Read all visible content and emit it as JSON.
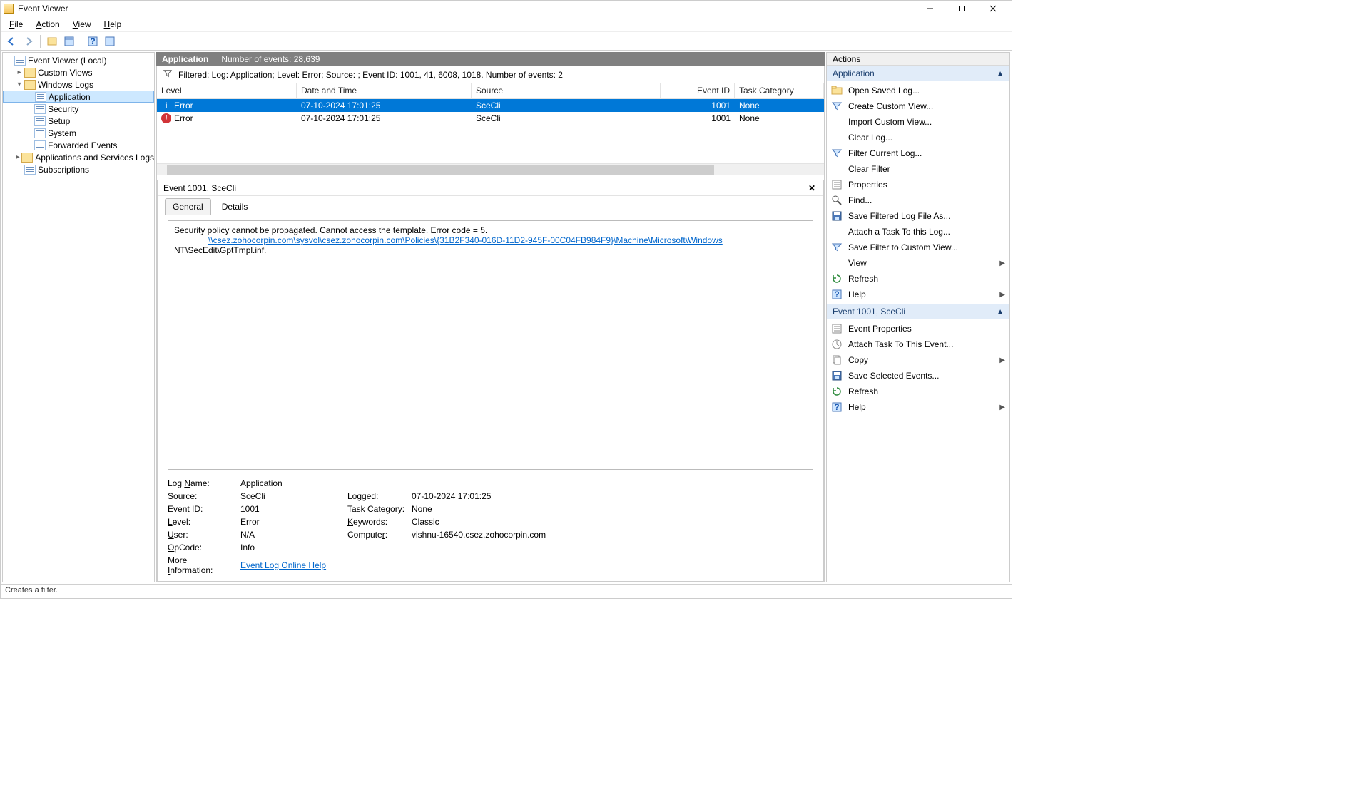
{
  "window": {
    "title": "Event Viewer"
  },
  "menu": {
    "file": "File",
    "action": "Action",
    "view": "View",
    "help": "Help"
  },
  "tree": {
    "root": "Event Viewer (Local)",
    "customViews": "Custom Views",
    "windowsLogs": "Windows Logs",
    "application": "Application",
    "security": "Security",
    "setup": "Setup",
    "system": "System",
    "forwarded": "Forwarded Events",
    "appsServices": "Applications and Services Logs",
    "subscriptions": "Subscriptions"
  },
  "centerHeader": {
    "title": "Application",
    "subtitle": "Number of events: 28,639"
  },
  "filterBar": "Filtered: Log: Application; Level: Error; Source: ; Event ID: 1001, 41, 6008, 1018. Number of events: 2",
  "columns": {
    "level": "Level",
    "date": "Date and Time",
    "source": "Source",
    "id": "Event ID",
    "cat": "Task Category"
  },
  "rows": [
    {
      "level": "Error",
      "date": "07-10-2024 17:01:25",
      "source": "SceCli",
      "id": "1001",
      "cat": "None",
      "selected": true,
      "icon": "info"
    },
    {
      "level": "Error",
      "date": "07-10-2024 17:01:25",
      "source": "SceCli",
      "id": "1001",
      "cat": "None",
      "selected": false,
      "icon": "error"
    }
  ],
  "detail": {
    "header": "Event 1001, SceCli",
    "tabs": {
      "general": "General",
      "details": "Details"
    },
    "msg_line1": "Security policy cannot be propagated. Cannot access the template. Error code = 5.",
    "msg_link": "\\\\csez.zohocorpin.com\\sysvol\\csez.zohocorpin.com\\Policies\\{31B2F340-016D-11D2-945F-00C04FB984F9}\\Machine\\Microsoft\\Windows",
    "msg_tail": " NT\\SecEdit\\GptTmpl.inf.",
    "props": {
      "logNameLbl": "Log Name:",
      "logName": "Application",
      "sourceLbl": "Source:",
      "source": "SceCli",
      "loggedLbl": "Logged:",
      "logged": "07-10-2024 17:01:25",
      "eventIdLbl": "Event ID:",
      "eventId": "1001",
      "taskCatLbl": "Task Category:",
      "taskCat": "None",
      "levelLbl": "Level:",
      "level": "Error",
      "keywordsLbl": "Keywords:",
      "keywords": "Classic",
      "userLbl": "User:",
      "user": "N/A",
      "computerLbl": "Computer:",
      "computer": "vishnu-16540.csez.zohocorpin.com",
      "opCodeLbl": "OpCode:",
      "opCode": "Info",
      "moreInfoLbl": "More Information:",
      "moreInfo": "Event Log Online Help"
    }
  },
  "actions": {
    "title": "Actions",
    "section1": "Application",
    "items1": [
      {
        "label": "Open Saved Log...",
        "icon": "folder"
      },
      {
        "label": "Create Custom View...",
        "icon": "funnel"
      },
      {
        "label": "Import Custom View...",
        "icon": "blank"
      },
      {
        "label": "Clear Log...",
        "icon": "blank"
      },
      {
        "label": "Filter Current Log...",
        "icon": "funnel"
      },
      {
        "label": "Clear Filter",
        "icon": "blank"
      },
      {
        "label": "Properties",
        "icon": "props"
      },
      {
        "label": "Find...",
        "icon": "find"
      },
      {
        "label": "Save Filtered Log File As...",
        "icon": "save"
      },
      {
        "label": "Attach a Task To this Log...",
        "icon": "blank"
      },
      {
        "label": "Save Filter to Custom View...",
        "icon": "funnel"
      },
      {
        "label": "View",
        "icon": "blank",
        "sub": "▶"
      },
      {
        "label": "Refresh",
        "icon": "refresh"
      },
      {
        "label": "Help",
        "icon": "help",
        "sub": "▶"
      }
    ],
    "section2": "Event 1001, SceCli",
    "items2": [
      {
        "label": "Event Properties",
        "icon": "props"
      },
      {
        "label": "Attach Task To This Event...",
        "icon": "task"
      },
      {
        "label": "Copy",
        "icon": "copy",
        "sub": "▶"
      },
      {
        "label": "Save Selected Events...",
        "icon": "save"
      },
      {
        "label": "Refresh",
        "icon": "refresh"
      },
      {
        "label": "Help",
        "icon": "help",
        "sub": "▶"
      }
    ]
  },
  "status": "Creates a filter."
}
